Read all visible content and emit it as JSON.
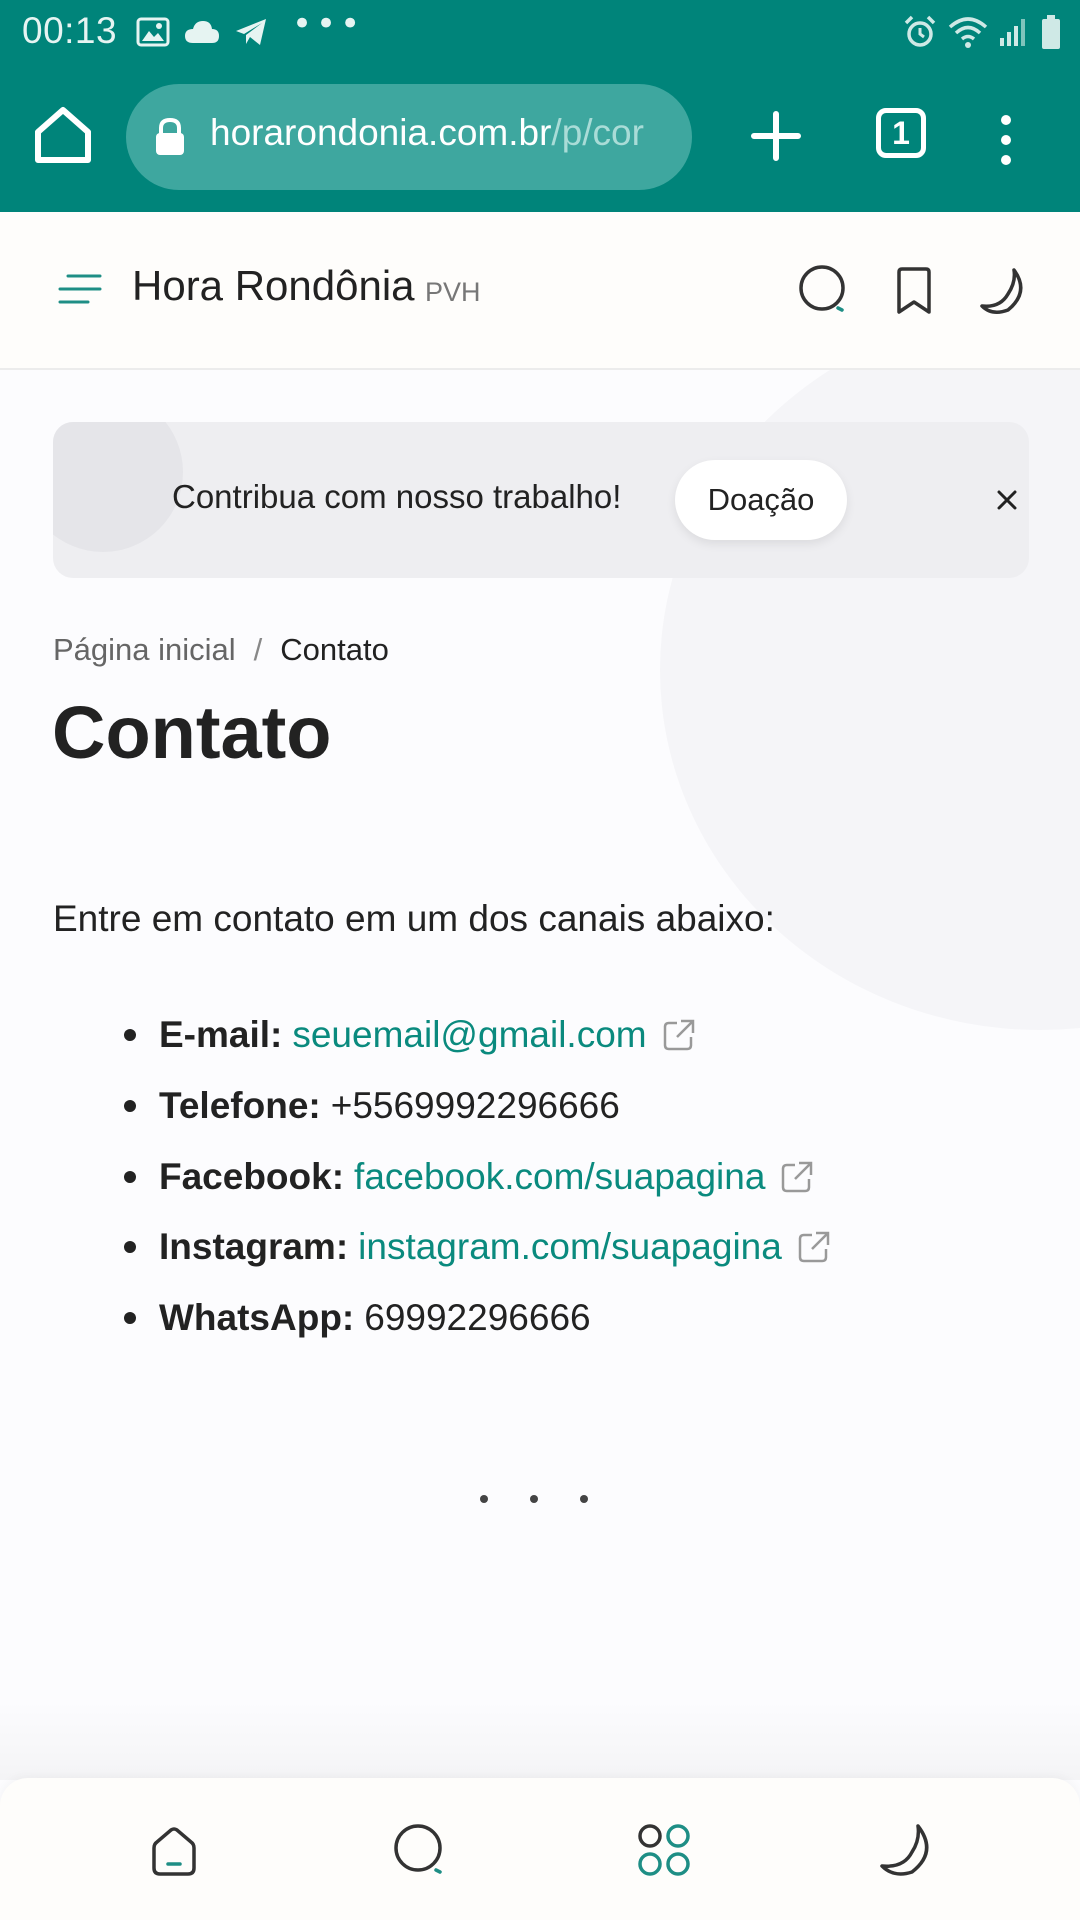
{
  "status_bar": {
    "time": "00:13"
  },
  "browser": {
    "url_host": "horarondonia.com.br",
    "url_path": "/p/cor",
    "tab_count": "1"
  },
  "site": {
    "brand": "Hora Rondônia",
    "brand_sub": "PVH"
  },
  "banner": {
    "text": "Contribua com nosso trabalho!",
    "button": "Doação"
  },
  "breadcrumb": {
    "home": "Página inicial",
    "separator": "/",
    "current": "Contato"
  },
  "page": {
    "title": "Contato",
    "intro": "Entre em contato em um dos canais abaixo:"
  },
  "contacts": [
    {
      "label": "E-mail:",
      "value": "seuemail@gmail.com",
      "is_link": true
    },
    {
      "label": "Telefone:",
      "value": "+5569992296666",
      "is_link": false
    },
    {
      "label": "Facebook:",
      "value": "facebook.com/suapagina",
      "is_link": true
    },
    {
      "label": "Instagram:",
      "value": "instagram.com/suapagina",
      "is_link": true
    },
    {
      "label": "WhatsApp:",
      "value": "69992296666",
      "is_link": false
    }
  ],
  "colors": {
    "browser_bar": "#00847a",
    "link": "#0a8a7e",
    "accent_teal": "#1e8e85"
  },
  "icons": {
    "bottom_nav": [
      "home-icon",
      "search-icon",
      "apps-icon",
      "moon-icon"
    ]
  }
}
